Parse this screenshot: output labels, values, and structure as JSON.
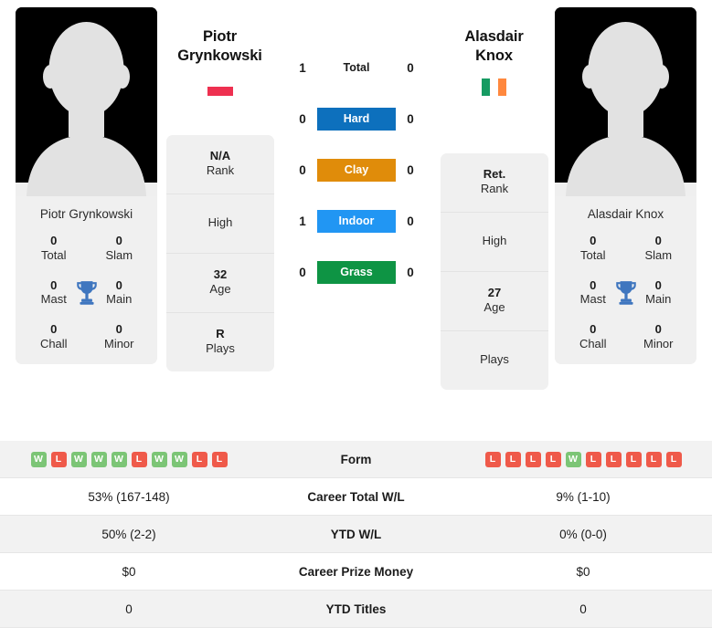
{
  "players": {
    "left": {
      "first_name": "Piotr",
      "last_name": "Grynkowski",
      "full_name": "Piotr Grynkowski",
      "country_code": "POL",
      "flag_colors": [
        "#ffffff",
        "#ee3050"
      ],
      "flag_orientation": "horizontal",
      "titles": {
        "total": "0",
        "total_label": "Total",
        "slam": "0",
        "slam_label": "Slam",
        "mast": "0",
        "mast_label": "Mast",
        "main": "0",
        "main_label": "Main",
        "chall": "0",
        "chall_label": "Chall",
        "minor": "0",
        "minor_label": "Minor"
      },
      "info": {
        "rank_value": "N/A",
        "rank_label": "Rank",
        "high_value": "",
        "high_label": "High",
        "age_value": "32",
        "age_label": "Age",
        "plays_value": "R",
        "plays_label": "Plays"
      },
      "form": [
        "W",
        "L",
        "W",
        "W",
        "W",
        "L",
        "W",
        "W",
        "L",
        "L"
      ],
      "career_total_wl": "53% (167-148)",
      "ytd_wl": "50% (2-2)",
      "career_prize_money": "$0",
      "ytd_titles": "0"
    },
    "right": {
      "first_name": "Alasdair",
      "last_name": "Knox",
      "full_name": "Alasdair Knox",
      "country_code": "IRL",
      "flag_colors": [
        "#169b62",
        "#ffffff",
        "#ff883e"
      ],
      "flag_orientation": "vertical",
      "titles": {
        "total": "0",
        "total_label": "Total",
        "slam": "0",
        "slam_label": "Slam",
        "mast": "0",
        "mast_label": "Mast",
        "main": "0",
        "main_label": "Main",
        "chall": "0",
        "chall_label": "Chall",
        "minor": "0",
        "minor_label": "Minor"
      },
      "info": {
        "rank_value": "Ret.",
        "rank_label": "Rank",
        "high_value": "",
        "high_label": "High",
        "age_value": "27",
        "age_label": "Age",
        "plays_value": "",
        "plays_label": "Plays"
      },
      "form": [
        "L",
        "L",
        "L",
        "L",
        "W",
        "L",
        "L",
        "L",
        "L",
        "L"
      ],
      "career_total_wl": "9% (1-10)",
      "ytd_wl": "0% (0-0)",
      "career_prize_money": "$0",
      "ytd_titles": "0"
    }
  },
  "head_to_head": {
    "surfaces": [
      {
        "label": "Total",
        "left": "1",
        "right": "0",
        "color": "transparent",
        "pill": false
      },
      {
        "label": "Hard",
        "left": "0",
        "right": "0",
        "color": "#0d70bd",
        "pill": true
      },
      {
        "label": "Clay",
        "left": "0",
        "right": "0",
        "color": "#e08c0a",
        "pill": true
      },
      {
        "label": "Indoor",
        "left": "1",
        "right": "0",
        "color": "#2196f3",
        "pill": true
      },
      {
        "label": "Grass",
        "left": "0",
        "right": "0",
        "color": "#0e9444",
        "pill": true
      }
    ]
  },
  "stats_table": {
    "rows": [
      {
        "label": "Form",
        "type": "form"
      },
      {
        "label": "Career Total W/L",
        "type": "text",
        "left": "53% (167-148)",
        "right": "9% (1-10)"
      },
      {
        "label": "YTD W/L",
        "type": "text",
        "left": "50% (2-2)",
        "right": "0% (0-0)"
      },
      {
        "label": "Career Prize Money",
        "type": "text",
        "left": "$0",
        "right": "$0"
      },
      {
        "label": "YTD Titles",
        "type": "text",
        "left": "0",
        "right": "0"
      }
    ]
  },
  "icons": {
    "trophy": "trophy-icon",
    "avatar": "avatar-placeholder-icon"
  },
  "colors": {
    "win": "#7cc576",
    "loss": "#ef5a4a",
    "card_bg": "#f0f0f0",
    "row_alt_bg": "#f2f2f2"
  }
}
